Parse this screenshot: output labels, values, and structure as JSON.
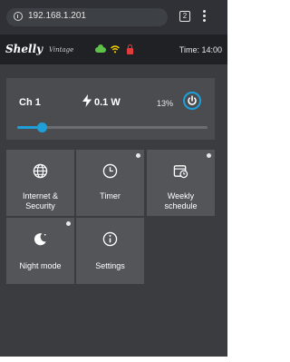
{
  "browser": {
    "url": "192.168.1.201",
    "tabs_count": "2",
    "icons": [
      "info-icon",
      "tabs-icon",
      "kebab-menu-icon"
    ]
  },
  "header": {
    "logo_main": "Shelly",
    "logo_sub": "Vintage",
    "time_label": "Time: 14:00",
    "status_icons": [
      "cloud-icon",
      "wifi-icon",
      "lock-icon"
    ],
    "status_colors": {
      "cloud": "#5ec24a",
      "wifi": "#f5d000",
      "lock": "#e23b3b"
    }
  },
  "channel": {
    "name": "Ch 1",
    "power": "0.1 W",
    "brightness_label": "13%",
    "brightness_value": 13,
    "accent_color": "#1e9fd8"
  },
  "tiles": [
    {
      "label_line1": "Internet &",
      "label_line2": "Security",
      "icon": "globe-icon",
      "has_dot": false
    },
    {
      "label_line1": "Timer",
      "label_line2": "",
      "icon": "clock-icon",
      "has_dot": true
    },
    {
      "label_line1": "Weekly",
      "label_line2": "schedule",
      "icon": "calendar-icon",
      "has_dot": true
    },
    {
      "label_line1": "Night mode",
      "label_line2": "",
      "icon": "moon-icon",
      "has_dot": true
    },
    {
      "label_line1": "Settings",
      "label_line2": "",
      "icon": "info-circle-icon",
      "has_dot": false
    }
  ]
}
